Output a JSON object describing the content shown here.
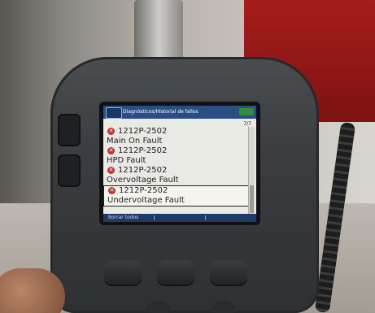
{
  "screen": {
    "title": "Diagnósticos/Historial de fallos",
    "counter": "7/7",
    "faults": [
      {
        "code": "1212P-2502",
        "desc": "Main On Fault",
        "selected": false
      },
      {
        "code": "1212P-2502",
        "desc": "HPD Fault",
        "selected": false
      },
      {
        "code": "1212P-2502",
        "desc": "Overvoltage Fault",
        "selected": false
      },
      {
        "code": "1212P-2502",
        "desc": "Undervoltage Fault",
        "selected": true
      }
    ],
    "softkeys": {
      "left": "Borrar todos"
    },
    "icons": {
      "app": "handheld-icon",
      "fault": "x-circle-icon",
      "status": "battery-icon"
    },
    "colors": {
      "titlebar": "#2a4e84",
      "fault_icon": "#c9332c",
      "screen_bg": "#e9eae4"
    }
  }
}
